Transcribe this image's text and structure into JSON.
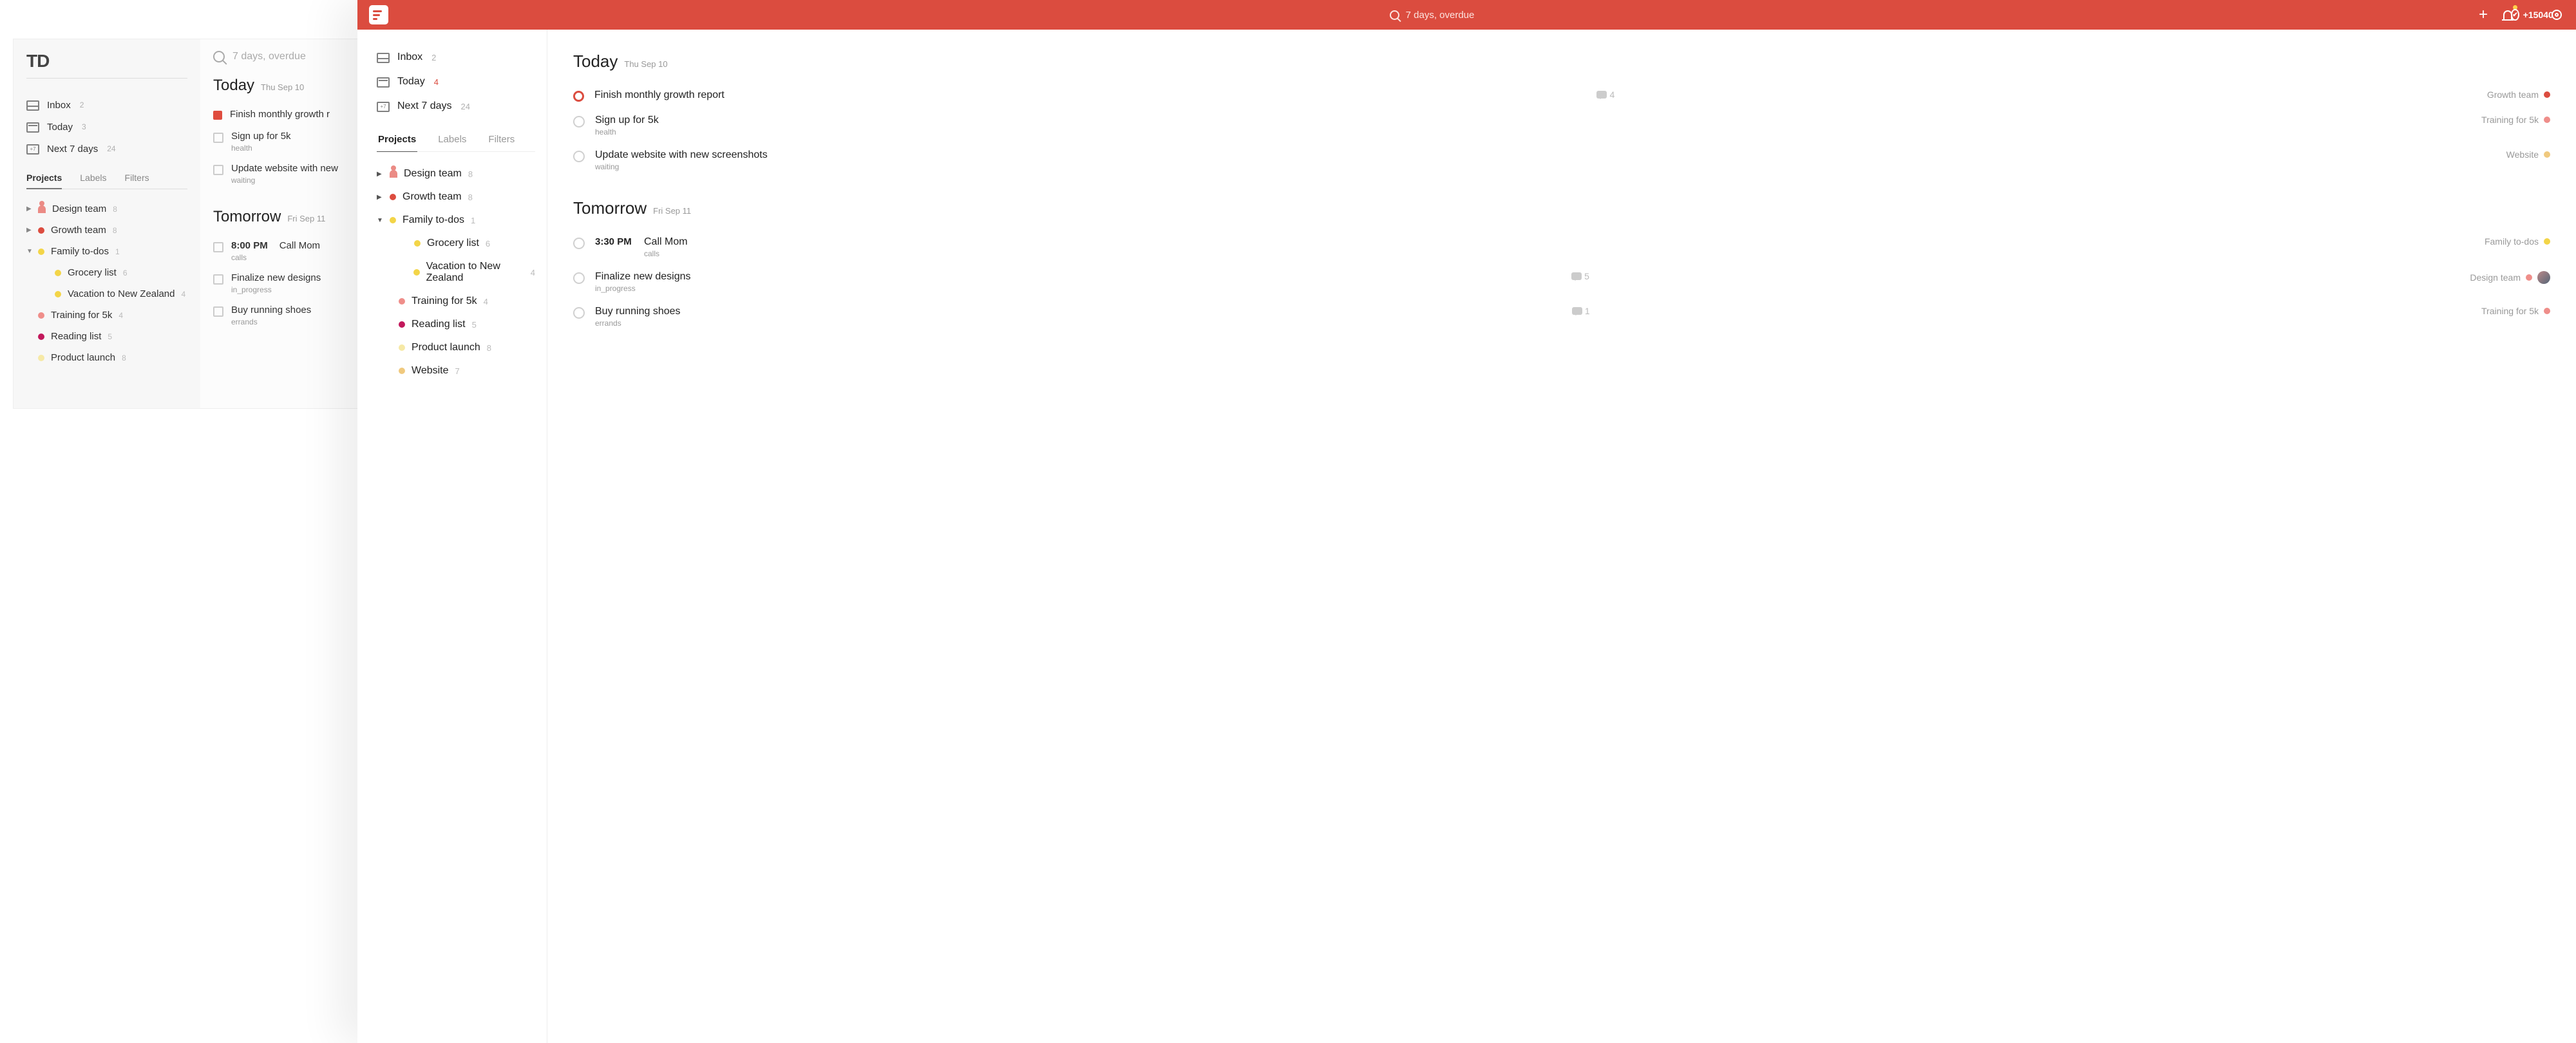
{
  "left": {
    "logo": "TD",
    "nav": {
      "inbox": {
        "label": "Inbox",
        "count": "2"
      },
      "today": {
        "label": "Today",
        "count": "3"
      },
      "next7": {
        "label": "Next 7 days",
        "count": "24"
      }
    },
    "tabs": {
      "projects": "Projects",
      "labels": "Labels",
      "filters": "Filters"
    },
    "projects": [
      {
        "caret": "▶",
        "name": "Design team",
        "count": "8",
        "color": "#e69b93",
        "person": true
      },
      {
        "caret": "▶",
        "name": "Growth team",
        "count": "8",
        "color": "#dc4c3f"
      },
      {
        "caret": "▼",
        "name": "Family to-dos",
        "count": "1",
        "color": "#f3d548"
      },
      {
        "caret": "",
        "name": "Grocery list",
        "count": "6",
        "color": "#f3d548",
        "child": true
      },
      {
        "caret": "",
        "name": "Vacation to New Zealand",
        "count": "4",
        "color": "#f3d548",
        "child": true
      },
      {
        "caret": "",
        "name": "Training for 5k",
        "count": "4",
        "color": "#ef8e8a"
      },
      {
        "caret": "",
        "name": "Reading list",
        "count": "5",
        "color": "#c2185b"
      },
      {
        "caret": "",
        "name": "Product launch",
        "count": "8",
        "color": "#f6e9a6"
      }
    ],
    "search_placeholder": "7 days, overdue",
    "today": {
      "title": "Today",
      "sub": "Thu Sep 10"
    },
    "tomorrow": {
      "title": "Tomorrow",
      "sub": "Fri Sep 11"
    },
    "today_tasks": [
      {
        "title": "Finish monthly growth r",
        "red": true
      },
      {
        "title": "Sign up for 5k",
        "tag": "health"
      },
      {
        "title": "Update website with new",
        "tag": "waiting"
      }
    ],
    "tomorrow_tasks": [
      {
        "time": "8:00 PM",
        "title": "Call Mom",
        "tag": "calls"
      },
      {
        "title": "Finalize new designs",
        "tag": "in_progress",
        "handle": true
      },
      {
        "title": "Buy running shoes",
        "tag": "errands",
        "handle": true
      }
    ]
  },
  "right": {
    "topbar": {
      "search": "7 days, overdue",
      "karma": "+15040"
    },
    "nav": {
      "inbox": {
        "label": "Inbox",
        "count": "2"
      },
      "today": {
        "label": "Today",
        "count": "4"
      },
      "next7": {
        "label": "Next 7 days",
        "count": "24"
      }
    },
    "tabs": {
      "projects": "Projects",
      "labels": "Labels",
      "filters": "Filters"
    },
    "projects": [
      {
        "caret": "▶",
        "name": "Design team",
        "count": "8",
        "person": true
      },
      {
        "caret": "▶",
        "name": "Growth team",
        "count": "8",
        "color": "#dc4c3f"
      },
      {
        "caret": "▼",
        "name": "Family to-dos",
        "count": "1",
        "color": "#f3d548"
      },
      {
        "caret": "",
        "name": "Grocery list",
        "count": "6",
        "color": "#f3d548",
        "child": true
      },
      {
        "caret": "",
        "name": "Vacation to New Zealand",
        "count": "4",
        "color": "#f3d548",
        "child": true
      },
      {
        "caret": "",
        "name": "Training for 5k",
        "count": "4",
        "color": "#ef8e8a",
        "sub": true
      },
      {
        "caret": "",
        "name": "Reading list",
        "count": "5",
        "color": "#c2185b",
        "sub": true
      },
      {
        "caret": "",
        "name": "Product launch",
        "count": "8",
        "color": "#f6e9a6",
        "sub": true
      },
      {
        "caret": "",
        "name": "Website",
        "count": "7",
        "color": "#f0c97e",
        "sub": true
      }
    ],
    "today": {
      "title": "Today",
      "sub": "Thu Sep 10"
    },
    "tomorrow": {
      "title": "Tomorrow",
      "sub": "Fri Sep 11"
    },
    "today_tasks": [
      {
        "title": "Finish monthly growth report",
        "red": true,
        "comments": "4",
        "project": "Growth team",
        "pcolor": "#dc4c3f"
      },
      {
        "title": "Sign up for 5k",
        "tag": "health",
        "project": "Training for 5k",
        "pcolor": "#ef8e8a"
      },
      {
        "title": "Update website with new screenshots",
        "tag": "waiting",
        "project": "Website",
        "pcolor": "#f0c97e"
      }
    ],
    "tomorrow_tasks": [
      {
        "time": "3:30 PM",
        "title": "Call Mom",
        "tag": "calls",
        "project": "Family to-dos",
        "pcolor": "#f3d548"
      },
      {
        "title": "Finalize new designs",
        "tag": "in_progress",
        "comments": "5",
        "project": "Design team",
        "pcolor": "#ef8e8a",
        "avatar": true
      },
      {
        "title": "Buy running shoes",
        "tag": "errands",
        "comments": "1",
        "project": "Training for 5k",
        "pcolor": "#ef8e8a"
      }
    ]
  }
}
